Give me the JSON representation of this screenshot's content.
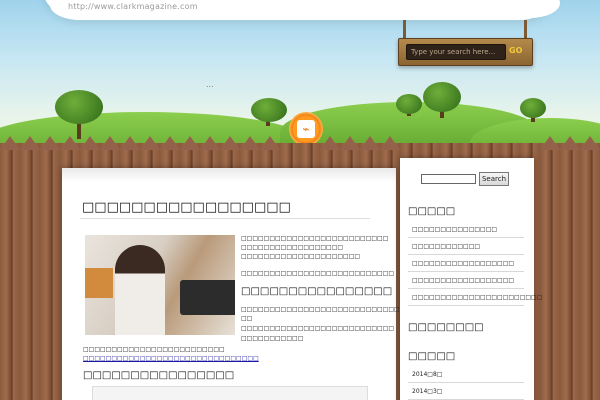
{
  "header": {
    "site_url": "http://www.clarkmagazine.com",
    "dots": "...",
    "search": {
      "placeholder": "Type your search here...",
      "go_label": "GO"
    }
  },
  "post": {
    "title": "□□□□□□□□□□□□□□□□□",
    "intro_lines": [
      "□□□□□□□□□□□□□□□□□□□□□□□□□□",
      "□□□□□□□□□□□□□□□□□□",
      "□□□□□□□□□□□□□□□□□□□□□"
    ],
    "line_after_intro": "□□□□□□□□□□□□□□□□□□□□□□□□□□□",
    "subheading": "□□□□□□□□□□□□□□□□",
    "sub_lines": [
      "□□□□□□□□□□□□□□□□□□□□□□□□□□□□□□□□□□",
      "□□",
      "□□□□□□□□□□□□□□□□□□□□□□□□□□□",
      "□□□□□□□□□□□"
    ],
    "bottom_line": "□□□□□□□□□□□□□□□□□□□□□□□□□",
    "bottom_link": "□□□□□□□□□□□□□□□□□□□□□□□□□□□□□□□",
    "section_heading": "□□□□□□□□□□□□□□□□"
  },
  "sidebar": {
    "search_button": "Search",
    "heading1": "□□□□□",
    "items": [
      "□□□□□□□□□□□□□□□",
      "□□□□□□□□□□□□",
      "□□□□□□□□□□□□□□□□□□",
      "□□□□□□□□□□□□□□□□□□",
      "□□□□□□□□□□□□□□□□□□□□□□□"
    ],
    "heading2": "□□□□□□□□",
    "heading3": "□□□□□",
    "archives": [
      "2014□8□",
      "2014□3□"
    ]
  },
  "colors": {
    "accent_link": "#1a1aa0",
    "rss_orange": "#f07c10",
    "fence_brown": "#8a5a3e"
  }
}
